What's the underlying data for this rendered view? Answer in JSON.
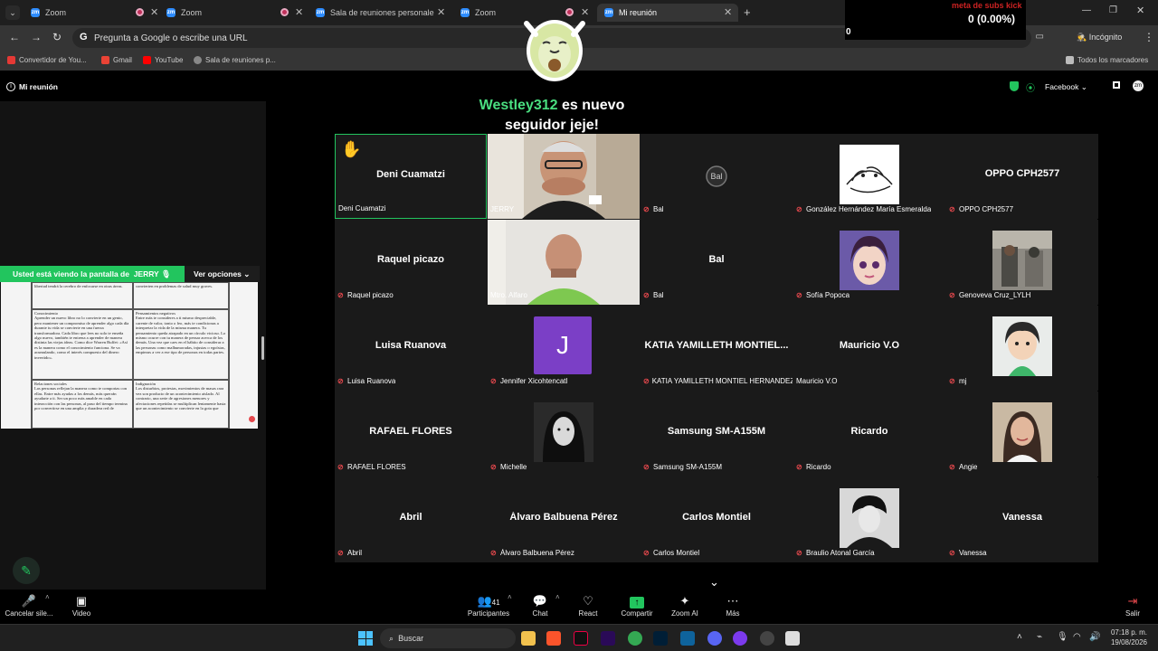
{
  "browser": {
    "tabs": [
      {
        "title": "Zoom"
      },
      {
        "title": "Zoom"
      },
      {
        "title": "Sala de reuniones personales d"
      },
      {
        "title": "Zoom"
      },
      {
        "title": "Mi reunión"
      }
    ],
    "new_tab": "+",
    "omnibox_placeholder": "Pregunta a Google o escribe una URL",
    "incognito_label": "Incógnito",
    "bookmarks": [
      "Convertidor de You...",
      "Gmail",
      "YouTube",
      "Sala de reuniones p..."
    ],
    "all_bookmarks": "Todos los marcadores"
  },
  "stream_overlay": {
    "goal_label": "meta de subs kick",
    "goal_value": "0 (0.00%)",
    "goal_start": "0",
    "alert_user": "Westley312",
    "alert_text": "es nuevo seguidor jeje!"
  },
  "meeting": {
    "title": "Mi reunión",
    "view_label": "Facebook"
  },
  "share": {
    "banner_text": "Usted está viendo la pantalla de",
    "sharer": "JERRY",
    "options_label": "Ver opciones",
    "doc_cells": [
      "libertad tendrá la cerebro de enfocarse en otras áreas.",
      "Conocimiento\nAprender un nuevo libro no lo convierte en un genio, pero mantener un compromiso de aprender algo cada día durante tu vida se convierte en una fuerza transformadora. Cada libro que lees no solo te enseña algo nuevo, también te entrena a aprender de manera distinta las viejas ideas. Como dice Warren Buffet: «Así es la manera como el conocimiento funciona. Se va acumulando, como el interés compuesto del dinero invertido».",
      "Relaciones sociales\nLas personas reflejan la manera como te comportas con ellas. Entre más ayudas a los demás, más querrán ayudarte a ti. Ser un poco más amable en cada interacción con las personas, al paso del tiempo termina por convertirse en una amplia y duradera red de",
      "convierten en problemas de salud muy graves.",
      "Pensamientos negativos\nEntre más te consideres a ti mismo despreciable, carente de valor, tonto o feo, más te condicionas a interpretar la vida de la misma manera. Tu pensamiento queda atrapado en un círculo vicioso. Lo mismo ocurre con tu manera de pensar acerca de los demás. Una vez que caes en el hábito de considerar a las personas como malhumoradas, injustas o egoístas, empiezas a ver a ese tipo de personas en todas partes.",
      "Indignación\nLos disturbios, protestas, movimientos de masas rara vez son producto de un acontecimiento aislado. Al contrario, una serie de agresiones menores y afectaciones repetidas se multiplican lentamente hasta que un acontecimiento se convierte en la gota que"
    ]
  },
  "participants": [
    {
      "display": "Deni Cuamatzi",
      "label": "Deni Cuamatzi",
      "muted": false,
      "kind": "hand"
    },
    {
      "display": "",
      "label": "JERRY",
      "muted": false,
      "kind": "video1"
    },
    {
      "display": "Bal",
      "label": "Bal",
      "muted": true,
      "kind": "avatar"
    },
    {
      "display": "",
      "label": "González Hernández María Esmeralda",
      "muted": true,
      "kind": "sketch"
    },
    {
      "display": "OPPO CPH2577",
      "label": "OPPO CPH2577",
      "muted": true,
      "kind": "name"
    },
    {
      "display": "Raquel picazo",
      "label": "Raquel picazo",
      "muted": true,
      "kind": "name"
    },
    {
      "display": "",
      "label": "Mtro. Alfaro",
      "muted": false,
      "kind": "video2"
    },
    {
      "display": "Bal",
      "label": "Bal",
      "muted": true,
      "kind": "name"
    },
    {
      "display": "",
      "label": "Sofía Popoca",
      "muted": true,
      "kind": "doll"
    },
    {
      "display": "",
      "label": "Genoveva Cruz_LYLH",
      "muted": true,
      "kind": "photo"
    },
    {
      "display": "Luisa Ruanova",
      "label": "Luisa Ruanova",
      "muted": true,
      "kind": "name"
    },
    {
      "display": "J",
      "label": "Jennifer Xicohtencatl",
      "muted": true,
      "kind": "letter"
    },
    {
      "display": "KATIA YAMILLETH MONTIEL...",
      "label": "KATIA YAMILLETH MONTIEL HERNANDEZ",
      "muted": true,
      "kind": "name"
    },
    {
      "display": "Mauricio V.O",
      "label": "Mauricio V.O",
      "muted": false,
      "kind": "name"
    },
    {
      "display": "",
      "label": "mj",
      "muted": true,
      "kind": "cartoon"
    },
    {
      "display": "RAFAEL FLORES",
      "label": "RAFAEL FLORES",
      "muted": true,
      "kind": "name"
    },
    {
      "display": "",
      "label": "Michelle",
      "muted": true,
      "kind": "bw"
    },
    {
      "display": "Samsung SM-A155M",
      "label": "Samsung SM-A155M",
      "muted": true,
      "kind": "name"
    },
    {
      "display": "Ricardo",
      "label": "Ricardo",
      "muted": true,
      "kind": "name"
    },
    {
      "display": "",
      "label": "Angie",
      "muted": true,
      "kind": "selfie"
    },
    {
      "display": "Abril",
      "label": "Abril",
      "muted": true,
      "kind": "name"
    },
    {
      "display": "Álvaro Balbuena Pérez",
      "label": "Álvaro Balbuena Pérez",
      "muted": true,
      "kind": "name"
    },
    {
      "display": "Carlos Montiel",
      "label": "Carlos Montiel",
      "muted": true,
      "kind": "name"
    },
    {
      "display": "",
      "label": "Braulio Atonal García",
      "muted": true,
      "kind": "bwman"
    },
    {
      "display": "Vanessa",
      "label": "Vanessa",
      "muted": true,
      "kind": "name"
    }
  ],
  "toolbar": {
    "unmute": "Cancelar sile...",
    "video": "Video",
    "participants": "Participantes",
    "participants_count": "41",
    "chat": "Chat",
    "react": "React",
    "share": "Compartir",
    "zoom_ai": "Zoom AI",
    "more": "Más",
    "leave": "Salir"
  },
  "taskbar": {
    "search": "Buscar",
    "time": "07:18 p. m.",
    "date": "19/08/2026"
  },
  "colors": {
    "accent_green": "#22c55e",
    "mute_red": "#e5484d",
    "alert_name": "#4ade80",
    "active_speaker": "#22c55e"
  }
}
